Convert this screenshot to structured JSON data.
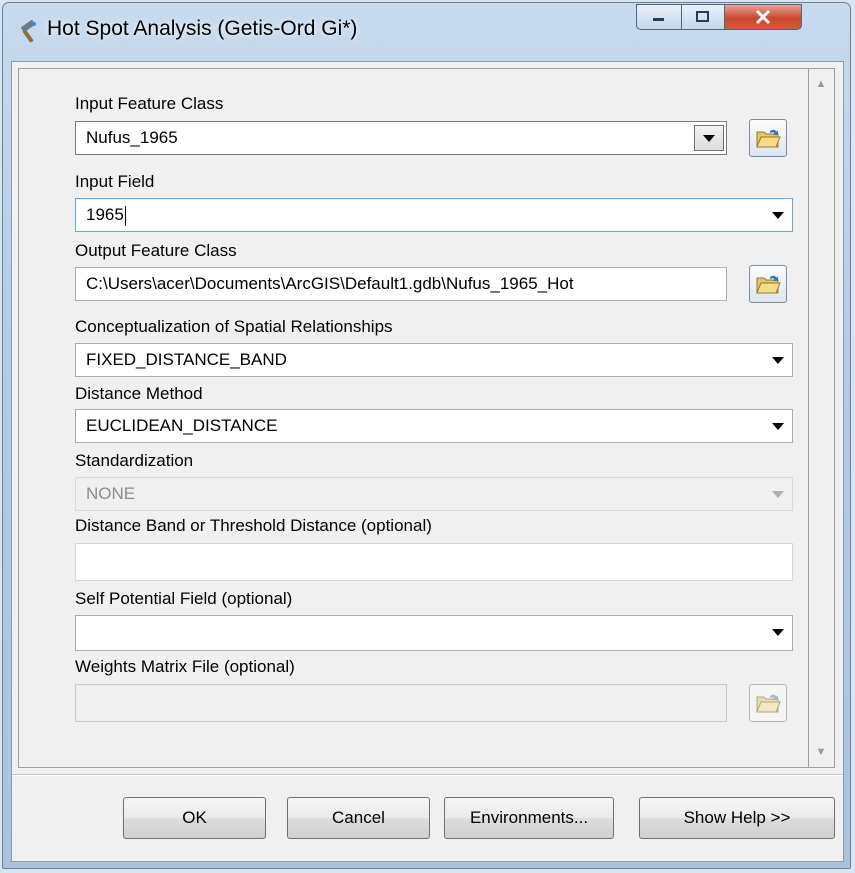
{
  "window": {
    "title": "Hot Spot Analysis (Getis-Ord Gi*)",
    "icon": "hammer-tool-icon"
  },
  "params": {
    "input_feature_class": {
      "label": "Input Feature Class",
      "value": "Nufus_1965"
    },
    "input_field": {
      "label": "Input Field",
      "value": "1965"
    },
    "output_feature_class": {
      "label": "Output Feature Class",
      "value": "C:\\Users\\acer\\Documents\\ArcGIS\\Default1.gdb\\Nufus_1965_Hot"
    },
    "conceptualization": {
      "label": "Conceptualization of Spatial Relationships",
      "value": "FIXED_DISTANCE_BAND"
    },
    "distance_method": {
      "label": "Distance Method",
      "value": "EUCLIDEAN_DISTANCE"
    },
    "standardization": {
      "label": "Standardization",
      "value": "NONE"
    },
    "distance_band": {
      "label": "Distance Band or Threshold Distance (optional)",
      "value": ""
    },
    "self_potential": {
      "label": "Self Potential Field (optional)",
      "value": ""
    },
    "weights_matrix": {
      "label": "Weights Matrix File (optional)",
      "value": ""
    }
  },
  "buttons": {
    "ok": "OK",
    "cancel": "Cancel",
    "environments": "Environments...",
    "show_help": "Show Help >>"
  },
  "colors": {
    "close_button": "#c8482e",
    "dialog_background": "#f0f0f0",
    "title_frame": "#b4cce6"
  }
}
